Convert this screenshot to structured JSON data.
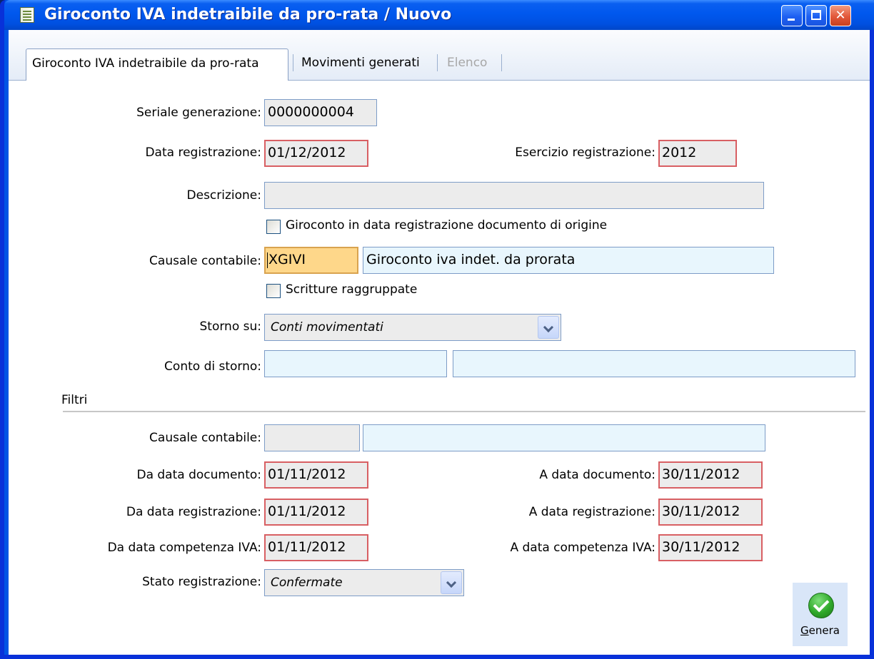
{
  "window": {
    "title": "Giroconto IVA indetraibile da pro-rata / Nuovo"
  },
  "tabs": [
    {
      "label": "Giroconto IVA indetraibile da pro-rata"
    },
    {
      "label": "Movimenti generati"
    },
    {
      "label": "Elenco"
    }
  ],
  "form": {
    "seriale_label": "Seriale generazione:",
    "seriale_value": "0000000004",
    "data_reg_label": "Data registrazione:",
    "data_reg_value": "01/12/2012",
    "esercizio_label": "Esercizio registrazione:",
    "esercizio_value": "2012",
    "descrizione_label": "Descrizione:",
    "descrizione_value": "",
    "chk_data_origine_label": "Giroconto in data registrazione documento di origine",
    "causale_label": "Causale contabile:",
    "causale_code": "XGIVI",
    "causale_desc": "Giroconto iva indet. da prorata",
    "chk_raggruppate_label": "Scritture raggruppate",
    "storno_label": "Storno su:",
    "storno_value": "Conti movimentati",
    "conto_storno_label": "Conto di storno:"
  },
  "filters": {
    "section_title": "Filtri",
    "causale_label": "Causale contabile:",
    "da_data_doc_label": "Da data documento:",
    "da_data_doc_value": "01/11/2012",
    "a_data_doc_label": "A data documento:",
    "a_data_doc_value": "30/11/2012",
    "da_data_reg_label": "Da data registrazione:",
    "da_data_reg_value": "01/11/2012",
    "a_data_reg_label": "A data registrazione:",
    "a_data_reg_value": "30/11/2012",
    "da_data_comp_label": "Da data competenza IVA:",
    "da_data_comp_value": "01/11/2012",
    "a_data_comp_label": "A data competenza IVA:",
    "a_data_comp_value": "30/11/2012",
    "stato_label": "Stato registrazione:",
    "stato_value": "Confermate"
  },
  "actions": {
    "genera_first": "G",
    "genera_rest": "enera"
  },
  "colors": {
    "required_border": "#d85f63",
    "focus_field": "#fed78a",
    "lookup_field": "#e8f6fd",
    "title_bar": "#0058ee"
  }
}
